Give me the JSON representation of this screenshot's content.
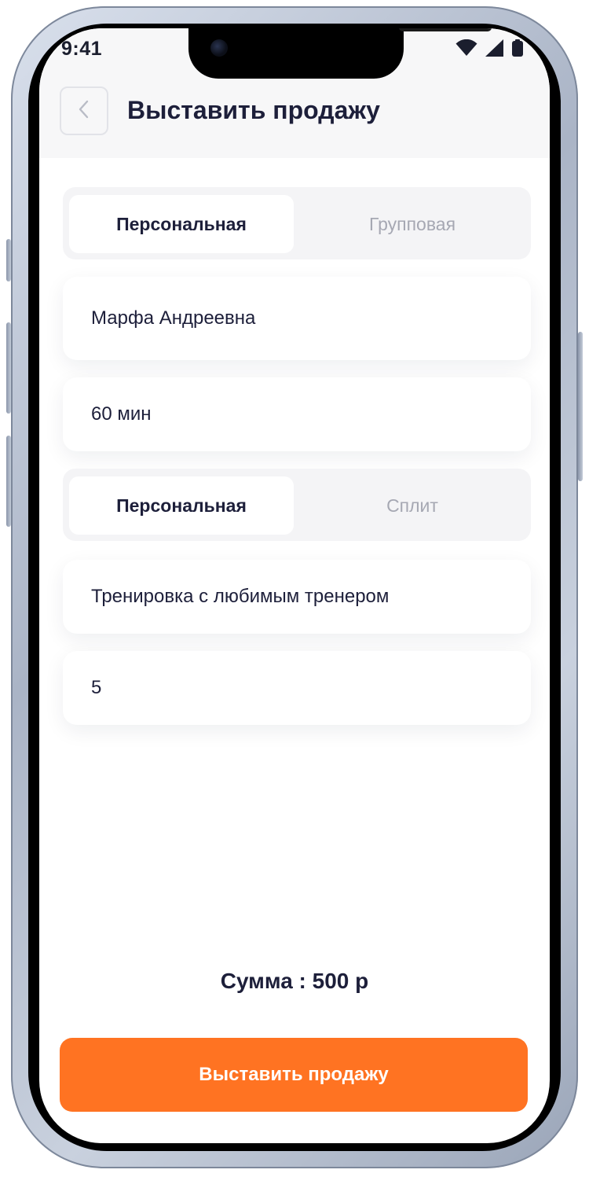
{
  "status_bar": {
    "time": "9:41",
    "icons": [
      "wifi-icon",
      "signal-icon",
      "battery-icon"
    ]
  },
  "header": {
    "back_icon": "chevron-left-icon",
    "title": "Выставить продажу"
  },
  "sale_type_segment": {
    "options": [
      "Персональная",
      "Групповая"
    ],
    "selected": "Персональная"
  },
  "fields": {
    "client": "Марфа Андреевна",
    "duration": "60 мин"
  },
  "training_type_segment": {
    "options": [
      "Персональная",
      "Сплит"
    ],
    "selected": "Персональная"
  },
  "fields2": {
    "service": "Тренировка с любимым тренером",
    "quantity": "5"
  },
  "summary": {
    "sum_text": "Сумма : 500 р"
  },
  "actions": {
    "submit_label": "Выставить продажу"
  },
  "colors": {
    "accent": "#ff7322",
    "text_primary": "#1d1f3a",
    "text_inactive": "#a6a8b3",
    "header_bg": "#f7f7f8"
  }
}
